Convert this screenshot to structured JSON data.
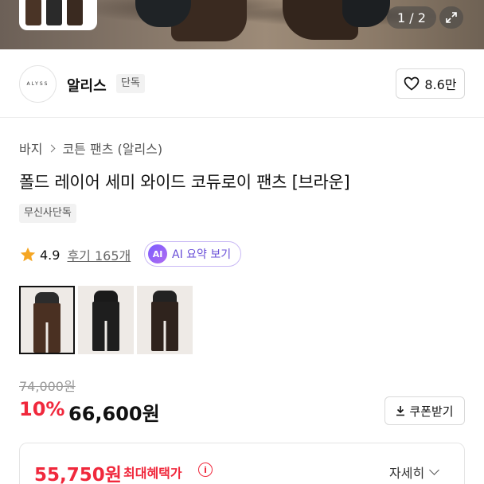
{
  "gallery": {
    "pager": "1 / 2"
  },
  "brand": {
    "logo_text": "ALYSS",
    "name": "알리스",
    "tag": "단독",
    "likes": "8.6만"
  },
  "product": {
    "breadcrumb": [
      "바지",
      "코튼 팬츠 (알리스)"
    ],
    "title": "폴드 레이어 세미 와이드 코듀로이 팬츠 [브라운]",
    "exclusive_tag": "무신사단독",
    "rating": "4.9",
    "review": "후기 165개",
    "ai_badge": "AI",
    "ai_label": "AI 요약 보기"
  },
  "color_options": [
    {
      "name": "brown",
      "selected": true,
      "color": "#4a3022"
    },
    {
      "name": "black",
      "selected": false,
      "color": "#1e1e1e"
    },
    {
      "name": "dark-brown",
      "selected": false,
      "color": "#2f231d"
    }
  ],
  "price": {
    "original": "74,000원",
    "discount": "10%",
    "sale": "66,600원",
    "coupon_label": "쿠폰받기"
  },
  "benefit": {
    "price": "55,750원",
    "label": "최대혜택가",
    "info_icon": "i",
    "more": "자세히"
  },
  "colors": {
    "accent_red": "#f0283c",
    "ai_purple": "#6a4fd8",
    "star": "#f5a623"
  }
}
